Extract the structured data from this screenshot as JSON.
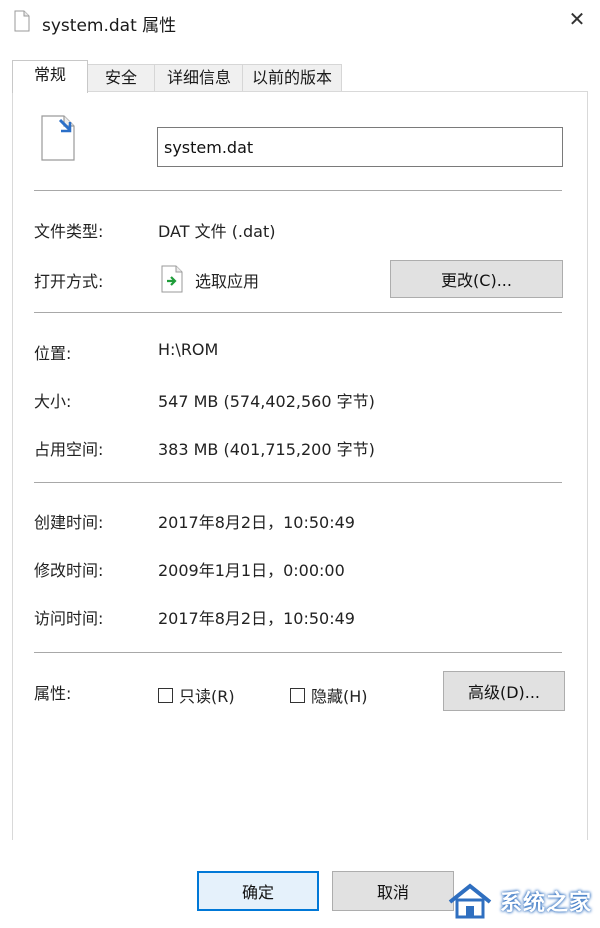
{
  "window": {
    "title": "system.dat 属性"
  },
  "tabs": [
    {
      "label": "常规"
    },
    {
      "label": "安全"
    },
    {
      "label": "详细信息"
    },
    {
      "label": "以前的版本"
    }
  ],
  "general": {
    "filename": "system.dat",
    "file_type_label": "文件类型:",
    "file_type_value": "DAT 文件 (.dat)",
    "open_with_label": "打开方式:",
    "open_with_value": "选取应用",
    "change_button": "更改(C)...",
    "location_label": "位置:",
    "location_value": "H:\\ROM",
    "size_label": "大小:",
    "size_value": "547 MB (574,402,560 字节)",
    "disk_size_label": "占用空间:",
    "disk_size_value": "383 MB (401,715,200 字节)",
    "created_label": "创建时间:",
    "created_value": "2017年8月2日，10:50:49",
    "modified_label": "修改时间:",
    "modified_value": "2009年1月1日，0:00:00",
    "accessed_label": "访问时间:",
    "accessed_value": "2017年8月2日，10:50:49",
    "attributes_label": "属性:",
    "readonly_label": "只读(R)",
    "hidden_label": "隐藏(H)",
    "advanced_button": "高级(D)..."
  },
  "footer": {
    "ok_button": "确定",
    "cancel_button": "取消"
  },
  "watermark": {
    "text": "系统之家"
  },
  "icons": {
    "close": "close-icon",
    "file": "file-icon",
    "open_with": "open-with-app-icon"
  },
  "colors": {
    "accent": "#0078d7",
    "separator": "#a8a8a8",
    "button_bg": "#e1e1e1"
  }
}
